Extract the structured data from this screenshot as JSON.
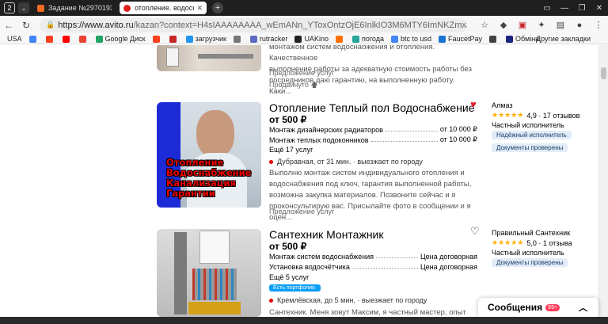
{
  "browser": {
    "tab_count": "2",
    "tabs": [
      {
        "title": "Задание №2970193 - про",
        "favicon_color": "#f26b21"
      },
      {
        "title": "отопление. водоснабж",
        "favicon_color": "#e02020"
      }
    ],
    "new_tab": "+",
    "url_host": "https://www.avito.ru",
    "url_path": "/kazan?context=H4sIAAAAAAAA_wEmANn_YToxOntzOjE6InlkIO3M6MTY6ImNKZmxJRnlXdVh..."
  },
  "bookmarks": [
    {
      "label": "USA",
      "color": "#ffffff"
    },
    {
      "label": "",
      "color": "#4285f4"
    },
    {
      "label": "",
      "color": "#fc3f1d"
    },
    {
      "label": "",
      "color": "#ff0000"
    },
    {
      "label": "",
      "color": "#ea4335"
    },
    {
      "label": "Google Диск",
      "color": "#1fa463"
    },
    {
      "label": "",
      "color": "#fc3f1d"
    },
    {
      "label": "",
      "color": "#c62828"
    },
    {
      "label": "загрузчик",
      "color": "#2196f3"
    },
    {
      "label": "",
      "color": "#777777"
    },
    {
      "label": "rutracker",
      "color": "#5c6bc0"
    },
    {
      "label": "UAKino",
      "color": "#222222"
    },
    {
      "label": "",
      "color": "#ff6f00"
    },
    {
      "label": "погода",
      "color": "#26a69a"
    },
    {
      "label": "btc to usd",
      "color": "#4285f4"
    },
    {
      "label": "FaucetPay",
      "color": "#1976d2"
    },
    {
      "label": "",
      "color": "#444444"
    },
    {
      "label": "Обмінн",
      "color": "#1a237e"
    }
  ],
  "other_bookmarks": "Другие закладки",
  "listings": [
    {
      "desc_lines": [
        "монтажом систем водоснабжения и отопления. Качественное",
        "выполнение работы за адекватную стоимость работы без",
        "посредников даю гарантию, на выполненную работу. Каки..."
      ],
      "label": "Предложение услуг",
      "pinned": "Продвинуто 🡅"
    },
    {
      "title": "Отопление Теплый пол Водоснабжение",
      "price": "от 500 ₽",
      "services": [
        {
          "name": "Монтаж дизайнерских радиаторов",
          "price": "от 10 000 ₽"
        },
        {
          "name": "Монтаж теплых подоконников",
          "price": "от 10 000 ₽"
        }
      ],
      "more": "Ещё 17 услуг",
      "location": "Дубравная, от 31 мин. · выезжает по городу",
      "desc_lines": [
        "Выполню монтаж систем индивидуального отопления и",
        "водоснабжения под ключ, гарантия выполненной работы,",
        "возможна закупка материалов. Позвоните сейчас и я",
        "проконсультирую вас. Присылайте фото в сообщении и я оцен..."
      ],
      "label": "Предложение услуг",
      "image_text": [
        "Отопление",
        "Водоснабжение",
        "Канализация",
        "Гарантии"
      ],
      "seller": {
        "name": "Алмаз",
        "stars": "★★★★★",
        "rating": "4,9",
        "reviews": "· 17 отзывов",
        "type": "Частный исполнитель",
        "badges": [
          "Надёжный исполнитель",
          "Документы проверены"
        ]
      }
    },
    {
      "title": "Сантехник Монтажник",
      "price": "от 500 ₽",
      "services": [
        {
          "name": "Монтаж систем водоснабжения",
          "price": "Цена договорная"
        },
        {
          "name": "Установка водосчётчика",
          "price": "Цена договорная"
        }
      ],
      "more": "Ещё 5 услуг",
      "portfolio": "Есть портфолио",
      "location": "Кремлёвская, до 5 мин. · выезжает по городу",
      "desc_lines": [
        "Сантехник. Меня зовут Максим, я частный мастер, опыт работы"
      ],
      "seller": {
        "name": "Правильный Сантехник",
        "stars": "★★★★★",
        "rating": "5,0",
        "reviews": "· 1 отзыва",
        "type": "Частный исполнитель",
        "badges": [
          "Документы проверены"
        ]
      }
    }
  ],
  "messages": {
    "label": "Сообщения",
    "count": "99+"
  }
}
